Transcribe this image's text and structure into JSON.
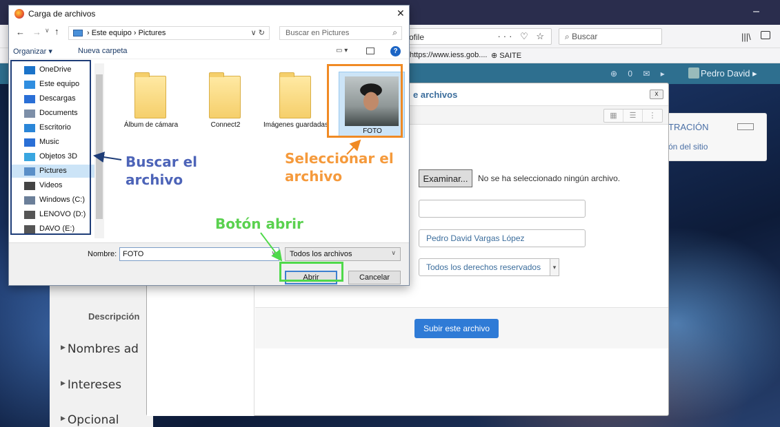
{
  "browser": {
    "url_fragment": "ofile",
    "url_actions": "··· ♡ ☆",
    "search_placeholder": "Buscar",
    "bookmarks": [
      "https://www.iess.gob....",
      "SAITE"
    ]
  },
  "site": {
    "header_icons": "⊕  0 ✉ ▸",
    "user_name": "Pedro David ▸",
    "admin_block_title": "TRACIÓN",
    "admin_block_link": "ón del sitio",
    "profile_label": "Descripción",
    "sections": [
      "Nombres ad",
      "Intereses",
      "Opcional"
    ]
  },
  "upload_modal": {
    "title": "e archivos",
    "close": "x",
    "browse_button": "Examinar...",
    "browse_status": "No se ha seleccionado ningún archivo.",
    "field_1_value": "",
    "author_value": "Pedro David Vargas López",
    "license_value": "Todos los derechos reservados",
    "submit": "Subir este archivo"
  },
  "file_dialog": {
    "title": "Carga de archivos",
    "breadcrumb": "›  Este equipo  ›  Pictures",
    "search_placeholder": "Buscar en Pictures",
    "organize": "Organizar ▾",
    "new_folder": "Nueva carpeta",
    "tree": [
      {
        "label": "OneDrive",
        "icon": "cloud-icon",
        "color": "#1a73c9"
      },
      {
        "label": "Este equipo",
        "icon": "computer-icon",
        "color": "#2f8ee0"
      },
      {
        "label": "Descargas",
        "icon": "download-icon",
        "color": "#2a6fd6"
      },
      {
        "label": "Documents",
        "icon": "document-icon",
        "color": "#7d8fa8"
      },
      {
        "label": "Escritorio",
        "icon": "desktop-icon",
        "color": "#2a86d8"
      },
      {
        "label": "Music",
        "icon": "music-icon",
        "color": "#2a6fd6"
      },
      {
        "label": "Objetos 3D",
        "icon": "cube-icon",
        "color": "#39a6e0"
      },
      {
        "label": "Pictures",
        "icon": "pictures-icon",
        "color": "#5a8fc8",
        "selected": true
      },
      {
        "label": "Videos",
        "icon": "video-icon",
        "color": "#444"
      },
      {
        "label": "Windows (C:)",
        "icon": "drive-icon",
        "color": "#6b7f99"
      },
      {
        "label": "LENOVO (D:)",
        "icon": "drive-icon",
        "color": "#555"
      },
      {
        "label": "DAVO (E:)",
        "icon": "drive-icon",
        "color": "#555"
      }
    ],
    "files": [
      {
        "label": "Álbum de cámara",
        "type": "folder"
      },
      {
        "label": "Connect2",
        "type": "folder"
      },
      {
        "label": "Imágenes guardadas",
        "type": "folder"
      },
      {
        "label": "FOTO",
        "type": "image",
        "selected": true
      }
    ],
    "name_label": "Nombre:",
    "name_value": "FOTO",
    "file_type": "Todos los archivos",
    "open": "Abrir",
    "cancel": "Cancelar"
  },
  "annotations": {
    "search": "Buscar el archivo",
    "select": "Seleccionar el archivo",
    "open": "Botón abrir",
    "colors": {
      "search": "#1d3c77",
      "select": "#f08a24",
      "open": "#4fd94a"
    }
  }
}
